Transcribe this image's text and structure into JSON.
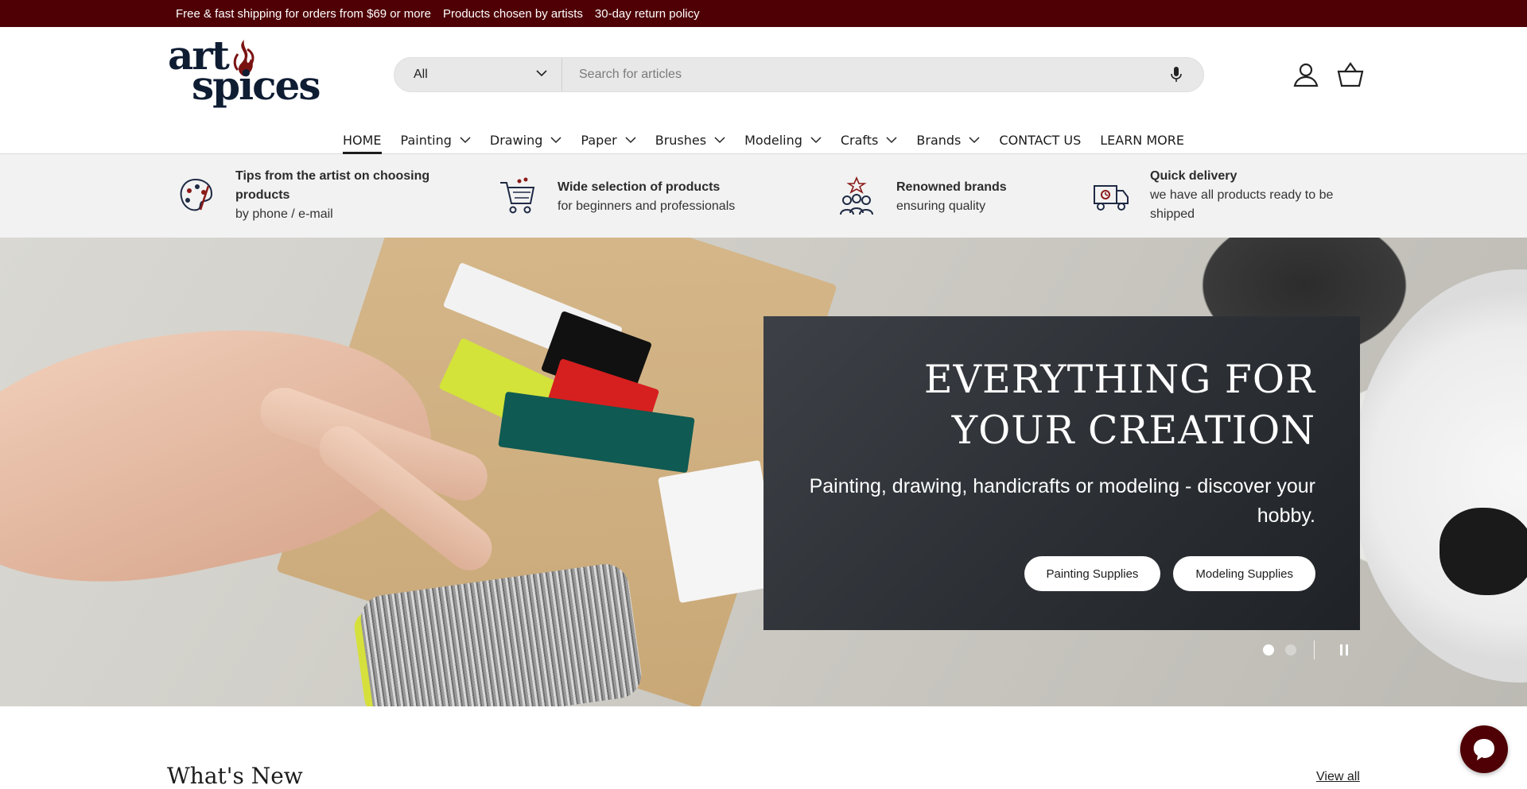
{
  "announcement": {
    "items": [
      "Free & fast shipping for orders from $69 or more",
      "Products chosen by artists",
      "30-day return policy"
    ]
  },
  "header": {
    "logo_line1": "art",
    "logo_line2": "spices",
    "search": {
      "category": "All",
      "placeholder": "Search for articles"
    }
  },
  "nav": {
    "items": [
      {
        "label": "HOME",
        "active": true
      },
      {
        "label": "Painting"
      },
      {
        "label": "Drawing"
      },
      {
        "label": "Paper"
      },
      {
        "label": "Brushes"
      },
      {
        "label": "Modeling"
      },
      {
        "label": "Crafts"
      },
      {
        "label": "Brands"
      },
      {
        "label": "CONTACT US"
      },
      {
        "label": "LEARN MORE"
      }
    ]
  },
  "features": [
    {
      "title": "Tips from the artist on choosing products",
      "text": "by phone / e-mail",
      "icon": "palette-icon"
    },
    {
      "title": "Wide selection of products",
      "text": "for beginners and professionals",
      "icon": "shopping-cart-icon"
    },
    {
      "title": "Renowned brands",
      "text": "ensuring quality",
      "icon": "award-people-icon"
    },
    {
      "title": "Quick delivery",
      "text": "we have all products ready to be shipped",
      "icon": "delivery-truck-icon"
    }
  ],
  "hero": {
    "title": "EVERYTHING FOR YOUR CREATION",
    "subtitle": "Painting, drawing, handicrafts or modeling - discover your hobby.",
    "buttons": [
      "Painting Supplies",
      "Modeling Supplies"
    ]
  },
  "whats_new": {
    "title": "What's New",
    "view_all": "View all"
  },
  "colors": {
    "brand": "#4f0005",
    "panel": "#2c3035"
  }
}
